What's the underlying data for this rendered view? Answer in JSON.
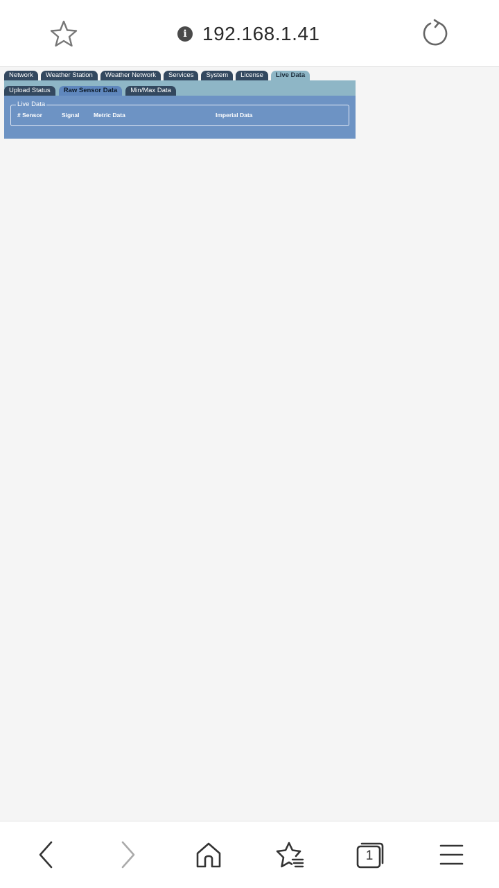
{
  "browser": {
    "url": "192.168.1.41",
    "tab_count": "1"
  },
  "page": {
    "main_tabs": [
      "Network",
      "Weather Station",
      "Weather Network",
      "Services",
      "System",
      "License",
      "Live Data"
    ],
    "active_main_tab": "Live Data",
    "sub_tabs": [
      "Upload Status",
      "Raw Sensor Data",
      "Min/Max Data"
    ],
    "active_sub_tab": "Raw Sensor Data",
    "fieldset_legend": "Live Data",
    "columns": [
      "# Sensor",
      "Signal",
      "Metric Data",
      "Imperial Data"
    ]
  },
  "icons": {
    "bookmark": "star-icon",
    "info": "info-icon",
    "reload": "reload-icon",
    "back": "chevron-left-icon",
    "forward": "chevron-right-icon",
    "home": "home-icon",
    "bookmarks_list": "bookmarks-icon",
    "tabs": "tabs-icon",
    "menu": "menu-icon"
  },
  "colors": {
    "tab_dark": "#33485f",
    "tab_active": "#8eb6c6",
    "panel_blue": "#6d93c4"
  }
}
